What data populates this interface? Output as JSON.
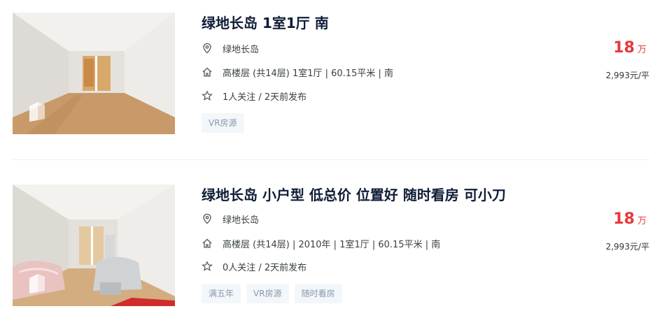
{
  "listings": [
    {
      "title": "绿地长岛 1室1厅 南",
      "community": "绿地长岛",
      "info": "高楼层 (共14层) 1室1厅 | 60.15平米 | 南",
      "follow": "1人关注 / 2天前发布",
      "tags": [
        "VR房源"
      ],
      "price": "18",
      "price_unit": "万",
      "unit_price": "2,993元/平"
    },
    {
      "title": "绿地长岛 小户型 低总价 位置好 随时看房 可小刀",
      "community": "绿地长岛",
      "info": "高楼层 (共14层) | 2010年 | 1室1厅 | 60.15平米 | 南",
      "follow": "0人关注 / 2天前发布",
      "tags": [
        "满五年",
        "VR房源",
        "随时看房"
      ],
      "price": "18",
      "price_unit": "万",
      "unit_price": "2,993元/平"
    }
  ],
  "icons": {
    "location": "location-pin-icon",
    "house": "house-icon",
    "star": "star-icon",
    "vr": "vr-badge-icon"
  },
  "colors": {
    "price": "#e4393c",
    "title": "#101d37",
    "tag_bg": "#f4f7f9",
    "tag_text": "#849aae"
  }
}
